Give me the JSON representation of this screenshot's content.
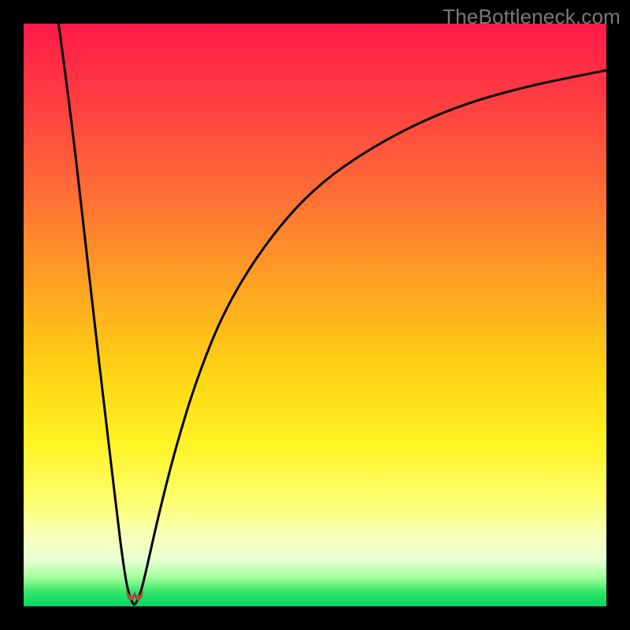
{
  "watermark": "TheBottleneck.com",
  "chart_data": {
    "type": "line",
    "title": "",
    "xlabel": "",
    "ylabel": "",
    "xlim": [
      0,
      100
    ],
    "ylim": [
      0,
      100
    ],
    "series": [
      {
        "name": "left-branch",
        "x_percent": [
          6.0,
          8.0,
          10.0,
          12.0,
          14.0,
          16.0,
          17.0,
          17.8,
          18.5,
          19.0
        ],
        "y_bottleneck": [
          100,
          85,
          68,
          50,
          33,
          16,
          8,
          3,
          1,
          0
        ]
      },
      {
        "name": "right-branch",
        "x_percent": [
          19.0,
          20.0,
          21.0,
          23.0,
          26.0,
          30.0,
          35.0,
          42.0,
          50.0,
          60.0,
          72.0,
          85.0,
          100.0
        ],
        "y_bottleneck": [
          0,
          2,
          6,
          15,
          27,
          40,
          52,
          63,
          72,
          79,
          85,
          89,
          92
        ]
      }
    ],
    "min_marker": {
      "x_percent": 19.0,
      "y_bottleneck": 0
    },
    "colors": {
      "curve": "#000000",
      "marker": "#b34b44",
      "gradient_top": "#ff1a49",
      "gradient_bottom": "#00d862"
    }
  }
}
